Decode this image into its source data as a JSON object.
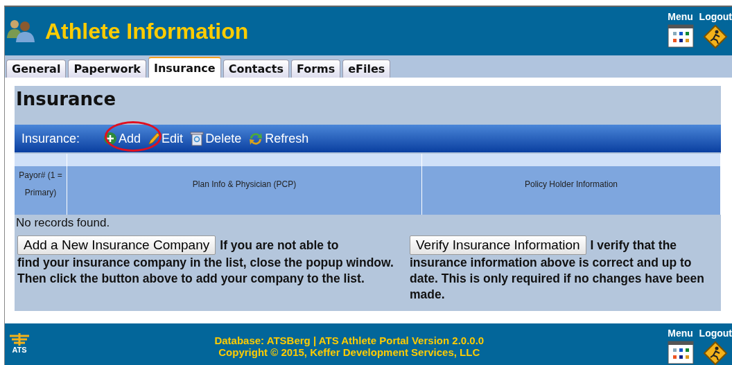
{
  "header": {
    "title": "Athlete Information",
    "links": [
      {
        "label": "Menu",
        "kind": "menu"
      },
      {
        "label": "Logout",
        "kind": "logout"
      }
    ]
  },
  "tabs": [
    {
      "label": "General",
      "selected": false
    },
    {
      "label": "Paperwork",
      "selected": false
    },
    {
      "label": "Insurance",
      "selected": true
    },
    {
      "label": "Contacts",
      "selected": false
    },
    {
      "label": "Forms",
      "selected": false
    },
    {
      "label": "eFiles",
      "selected": false
    }
  ],
  "section_title": "Insurance",
  "toolbar": {
    "label": "Insurance:",
    "actions": [
      {
        "label": "Add",
        "kind": "add",
        "highlighted": true
      },
      {
        "label": "Edit",
        "kind": "edit",
        "highlighted": false
      },
      {
        "label": "Delete",
        "kind": "delete",
        "highlighted": false
      },
      {
        "label": "Refresh",
        "kind": "refresh",
        "highlighted": false
      }
    ]
  },
  "table": {
    "columns": [
      "Payor# (1 = Primary)",
      "Plan Info & Physician (PCP)",
      "Policy Holder Information"
    ],
    "empty_text": "No records found."
  },
  "notes": [
    {
      "button": "Add a New Insurance Company",
      "lead": "If you are not able to",
      "text": "find your insurance company in the list, close the popup window. Then click the button above to add your company to the list."
    },
    {
      "button": "Verify Insurance Information",
      "lead": "I verify that the",
      "text": "insurance information above is correct and up to date. This is only required if no changes have been made."
    }
  ],
  "footer": {
    "logo": "ATS",
    "lines": [
      "Database: ATSBerg | ATS Athlete Portal Version 2.0.0.0",
      "Copyright © 2015, Keffer Development Services, LLC"
    ],
    "links": [
      {
        "label": "Menu",
        "kind": "menu"
      },
      {
        "label": "Logout",
        "kind": "logout"
      }
    ]
  }
}
